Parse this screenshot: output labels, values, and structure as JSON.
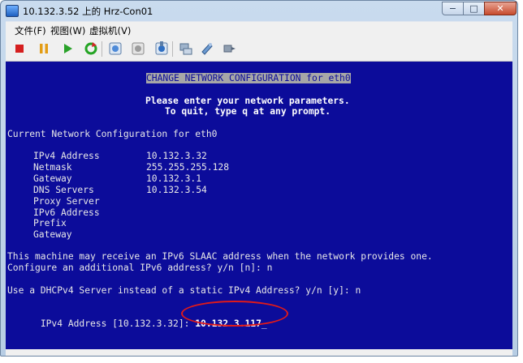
{
  "window": {
    "title": "10.132.3.52 上的 Hrz-Con01",
    "min_glyph": "−",
    "max_glyph": "□",
    "close_glyph": "✕"
  },
  "menu": [
    "文件(F)",
    "视图(W)",
    "虚拟机(V)"
  ],
  "toolbar": {
    "icons": [
      "stop-icon",
      "pause-icon",
      "play-icon",
      "reset-icon",
      "snapshot-icon",
      "revert-snapshot-icon",
      "snapshot-manager-icon",
      "network-icon",
      "settings-icon",
      "connect-device-icon"
    ]
  },
  "console": {
    "header": "CHANGE NETWORK CONFIGURATION for eth0",
    "prompt1": "Please enter your network parameters.",
    "prompt2": "To quit, type q at any prompt.",
    "section": "Current Network Configuration for eth0",
    "fields": [
      {
        "label": "IPv4 Address",
        "value": "10.132.3.32"
      },
      {
        "label": "Netmask",
        "value": "255.255.255.128"
      },
      {
        "label": "Gateway",
        "value": "10.132.3.1"
      },
      {
        "label": "DNS Servers",
        "value": "10.132.3.54"
      },
      {
        "label": "Proxy Server",
        "value": ""
      },
      {
        "label": "IPv6 Address",
        "value": ""
      },
      {
        "label": "Prefix",
        "value": ""
      },
      {
        "label": "Gateway",
        "value": ""
      }
    ],
    "slaac1": "This machine may receive an IPv6 SLAAC address when the network provides one.",
    "slaac2": "Configure an additional IPv6 address? y/n [n]: n",
    "dhcp": "Use a DHCPv4 Server instead of a static IPv4 Address? y/n [y]: n",
    "ipv4_prompt": "IPv4 Address [10.132.3.32]: ",
    "ipv4_input": "10.132.3.117",
    "cursor": "_"
  },
  "colors": {
    "console_bg": "#0c0c9a",
    "console_fg": "#e8e8e8",
    "annotation": "#e01a1a"
  }
}
